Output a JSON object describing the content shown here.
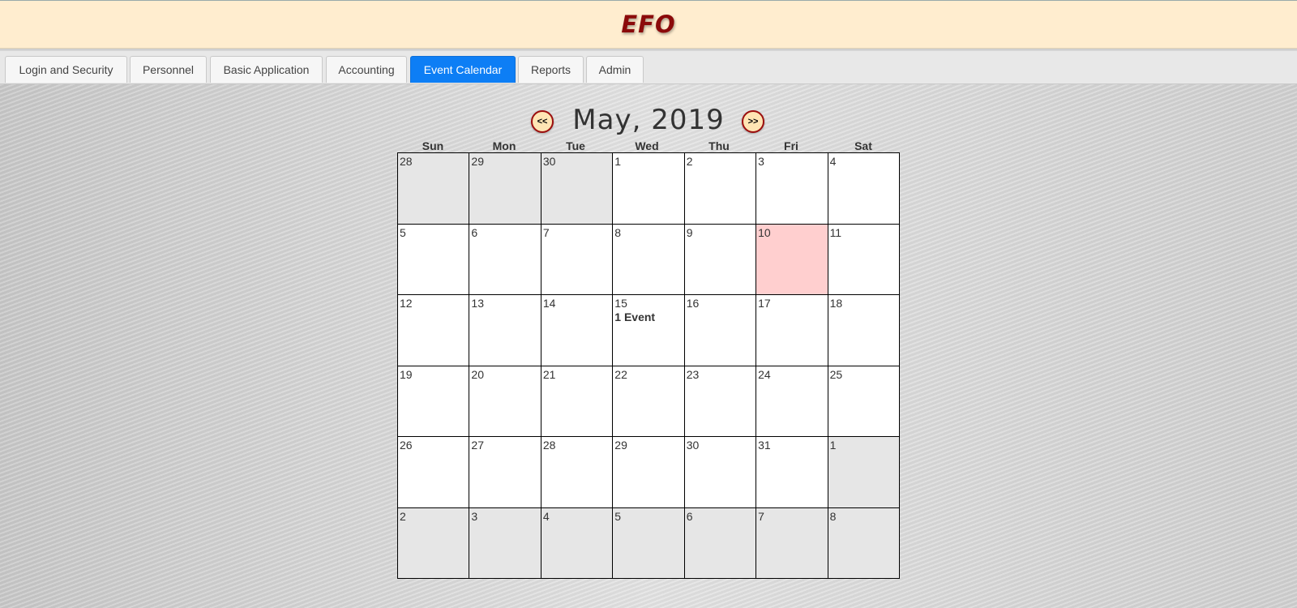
{
  "app": {
    "title": "EFO"
  },
  "nav": {
    "tabs": [
      {
        "label": "Login and Security"
      },
      {
        "label": "Personnel"
      },
      {
        "label": "Basic Application"
      },
      {
        "label": "Accounting"
      },
      {
        "label": "Event Calendar",
        "active": true
      },
      {
        "label": "Reports"
      },
      {
        "label": "Admin"
      }
    ]
  },
  "calendar": {
    "month_title": "May, 2019",
    "prev_label": "<<",
    "next_label": ">>",
    "weekdays": [
      "Sun",
      "Mon",
      "Tue",
      "Wed",
      "Thu",
      "Fri",
      "Sat"
    ],
    "days": [
      {
        "n": "28",
        "other": true
      },
      {
        "n": "29",
        "other": true
      },
      {
        "n": "30",
        "other": true
      },
      {
        "n": "1"
      },
      {
        "n": "2"
      },
      {
        "n": "3"
      },
      {
        "n": "4"
      },
      {
        "n": "5"
      },
      {
        "n": "6"
      },
      {
        "n": "7"
      },
      {
        "n": "8"
      },
      {
        "n": "9"
      },
      {
        "n": "10",
        "today": true
      },
      {
        "n": "11"
      },
      {
        "n": "12"
      },
      {
        "n": "13"
      },
      {
        "n": "14"
      },
      {
        "n": "15",
        "event": "1 Event"
      },
      {
        "n": "16"
      },
      {
        "n": "17"
      },
      {
        "n": "18"
      },
      {
        "n": "19"
      },
      {
        "n": "20"
      },
      {
        "n": "21"
      },
      {
        "n": "22"
      },
      {
        "n": "23"
      },
      {
        "n": "24"
      },
      {
        "n": "25"
      },
      {
        "n": "26"
      },
      {
        "n": "27"
      },
      {
        "n": "28"
      },
      {
        "n": "29"
      },
      {
        "n": "30"
      },
      {
        "n": "31"
      },
      {
        "n": "1",
        "other": true
      },
      {
        "n": "2",
        "other": true
      },
      {
        "n": "3",
        "other": true
      },
      {
        "n": "4",
        "other": true
      },
      {
        "n": "5",
        "other": true
      },
      {
        "n": "6",
        "other": true
      },
      {
        "n": "7",
        "other": true
      },
      {
        "n": "8",
        "other": true
      }
    ]
  },
  "colors": {
    "header_bg": "#ffedcf",
    "title": "#8b0a0a",
    "active_tab": "#0d7ef5",
    "today_cell": "#ffcfcf",
    "other_month_cell": "#e6e6e6"
  }
}
